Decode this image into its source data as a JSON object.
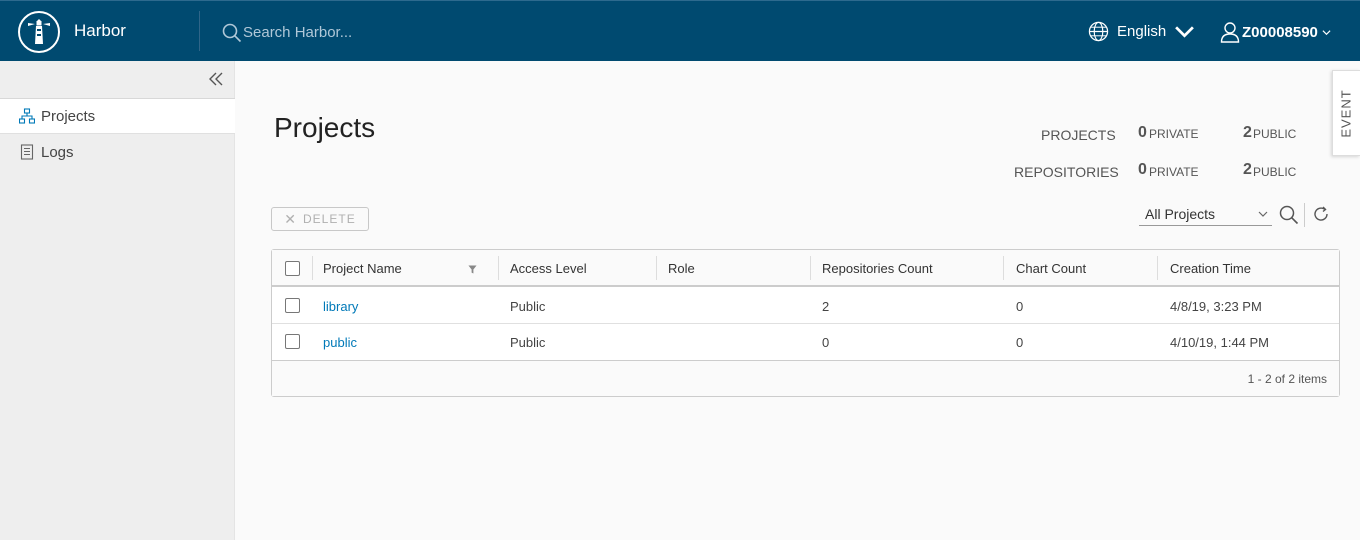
{
  "header": {
    "app_title": "Harbor",
    "search_placeholder": "Search Harbor...",
    "language": "English",
    "username": "Z00008590",
    "bg_color": "#004a70"
  },
  "sidebar": {
    "items": [
      {
        "label": "Projects",
        "icon": "projects-icon",
        "active": true
      },
      {
        "label": "Logs",
        "icon": "logs-icon",
        "active": false
      }
    ]
  },
  "event_tab": "EVENT",
  "main": {
    "title": "Projects",
    "stats": {
      "projects_label": "PROJECTS",
      "repositories_label": "REPOSITORIES",
      "projects_private": "0",
      "projects_public": "2",
      "repos_private": "0",
      "repos_public": "2",
      "private_label": "PRIVATE",
      "public_label": "PUBLIC"
    },
    "delete_label": "DELETE",
    "filter_value": "All Projects",
    "table": {
      "columns": [
        "Project Name",
        "Access Level",
        "Role",
        "Repositories Count",
        "Chart Count",
        "Creation Time"
      ],
      "rows": [
        {
          "name": "library",
          "access": "Public",
          "role": "",
          "repos": "2",
          "charts": "0",
          "created": "4/8/19, 3:23 PM"
        },
        {
          "name": "public",
          "access": "Public",
          "role": "",
          "repos": "0",
          "charts": "0",
          "created": "4/10/19, 1:44 PM"
        }
      ],
      "footer": "1 - 2 of 2 items"
    }
  }
}
